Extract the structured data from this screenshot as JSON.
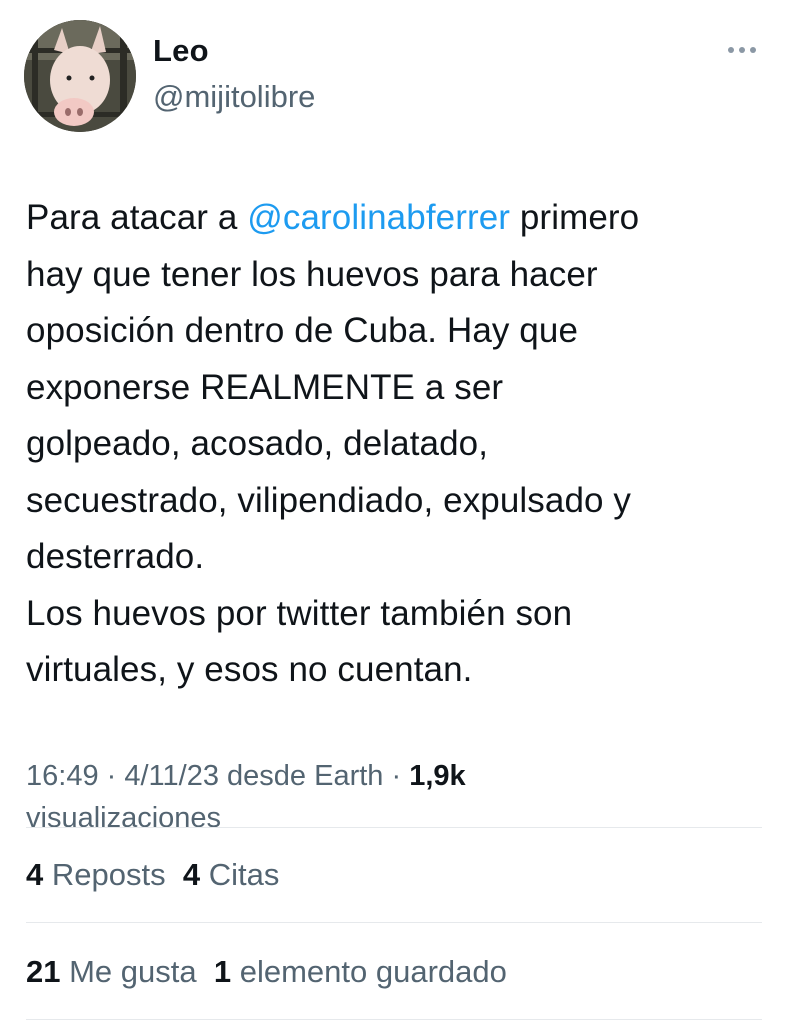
{
  "author": {
    "name": "Leo",
    "handle": "@mijitolibre"
  },
  "tweet": {
    "before_mention": "Para atacar a ",
    "mention": "@carolinabferrer",
    "after_mention": " primero\nhay que tener los huevos para hacer\noposición dentro de Cuba. Hay que\nexponerse REALMENTE a ser\ngolpeado, acosado, delatado,\nsecuestrado, vilipendiado, expulsado y\ndesterrado.\nLos huevos por twitter también son\nvirtuales, y esos no cuentan."
  },
  "meta": {
    "time": "16:49",
    "sep1": " · ",
    "date": "4/11/23",
    "source": " desde Earth",
    "sep2": " · ",
    "views_count": "1,9k",
    "views_label": "visualizaciones"
  },
  "stats": {
    "reposts_count": "4",
    "reposts_label": "Reposts",
    "quotes_count": "4",
    "quotes_label": "Citas",
    "likes_count": "21",
    "likes_label": "Me gusta",
    "bookmarks_count": "1",
    "bookmarks_label": "elemento guardado"
  },
  "icons": {
    "more": "more-options-icon",
    "avatar": "pig-avatar"
  },
  "colors": {
    "accent": "#1d9bf0",
    "text": "#0f1419",
    "secondary": "#536471"
  }
}
